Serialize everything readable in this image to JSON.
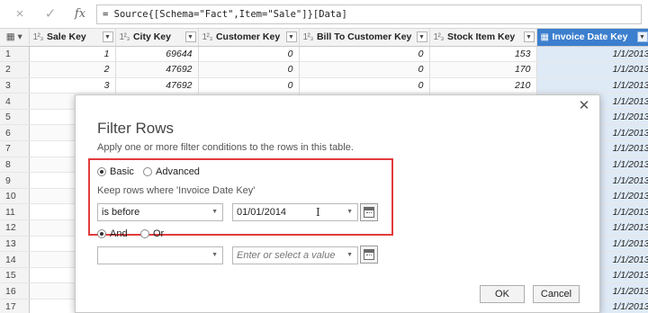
{
  "formula_bar": {
    "cancel_icon": "×",
    "confirm_icon": "✓",
    "fx_label": "fx",
    "formula": "= Source{[Schema=\"Fact\",Item=\"Sale\"]}[Data]"
  },
  "grid": {
    "corner_icon": "▦",
    "columns": [
      {
        "type": "1²₃",
        "name": "Sale Key"
      },
      {
        "type": "1²₃",
        "name": "City Key"
      },
      {
        "type": "1²₃",
        "name": "Customer Key"
      },
      {
        "type": "1²₃",
        "name": "Bill To Customer Key"
      },
      {
        "type": "1²₃",
        "name": "Stock Item Key"
      },
      {
        "type": "▦",
        "name": "Invoice Date Key"
      }
    ],
    "dropdown_glyph": "▼",
    "rows": [
      {
        "n": "1",
        "cells": [
          "1",
          "69644",
          "0",
          "0",
          "153",
          "1/1/2013"
        ]
      },
      {
        "n": "2",
        "cells": [
          "2",
          "47692",
          "0",
          "0",
          "170",
          "1/1/2013"
        ]
      },
      {
        "n": "3",
        "cells": [
          "3",
          "47692",
          "0",
          "0",
          "210",
          "1/1/2013"
        ]
      },
      {
        "n": "4",
        "cells": [
          "",
          "",
          "",
          "",
          "",
          "1/1/2013"
        ]
      },
      {
        "n": "5",
        "cells": [
          "",
          "",
          "",
          "",
          "",
          "1/1/2013"
        ]
      },
      {
        "n": "6",
        "cells": [
          "",
          "",
          "",
          "",
          "",
          "1/1/2013"
        ]
      },
      {
        "n": "7",
        "cells": [
          "",
          "",
          "",
          "",
          "",
          "1/1/2013"
        ]
      },
      {
        "n": "8",
        "cells": [
          "",
          "",
          "",
          "",
          "",
          "1/1/2013"
        ]
      },
      {
        "n": "9",
        "cells": [
          "",
          "",
          "",
          "",
          "",
          "1/1/2013"
        ]
      },
      {
        "n": "10",
        "cells": [
          "",
          "",
          "",
          "",
          "",
          "1/1/2013"
        ]
      },
      {
        "n": "11",
        "cells": [
          "",
          "",
          "",
          "",
          "",
          "1/1/2013"
        ]
      },
      {
        "n": "12",
        "cells": [
          "",
          "",
          "",
          "",
          "",
          "1/1/2013"
        ]
      },
      {
        "n": "13",
        "cells": [
          "",
          "",
          "",
          "",
          "",
          "1/1/2013"
        ]
      },
      {
        "n": "14",
        "cells": [
          "",
          "",
          "",
          "",
          "",
          "1/1/2013"
        ]
      },
      {
        "n": "15",
        "cells": [
          "",
          "",
          "",
          "",
          "",
          "1/1/2013"
        ]
      },
      {
        "n": "16",
        "cells": [
          "",
          "",
          "",
          "",
          "",
          "1/1/2013"
        ]
      },
      {
        "n": "17",
        "cells": [
          "",
          "",
          "",
          "",
          "",
          "1/1/2013"
        ]
      }
    ]
  },
  "dialog": {
    "close_icon": "✕",
    "title": "Filter Rows",
    "description": "Apply one or more filter conditions to the rows in this table.",
    "basic_label": "Basic",
    "advanced_label": "Advanced",
    "keep_rows_label": "Keep rows where 'Invoice Date Key'",
    "operator": "is before",
    "value": "01/01/2014",
    "and_label": "And",
    "or_label": "Or",
    "operator2": "",
    "value2_placeholder": "Enter or select a value",
    "ok_label": "OK",
    "cancel_label": "Cancel",
    "highlight_color": "#e23b3b"
  }
}
